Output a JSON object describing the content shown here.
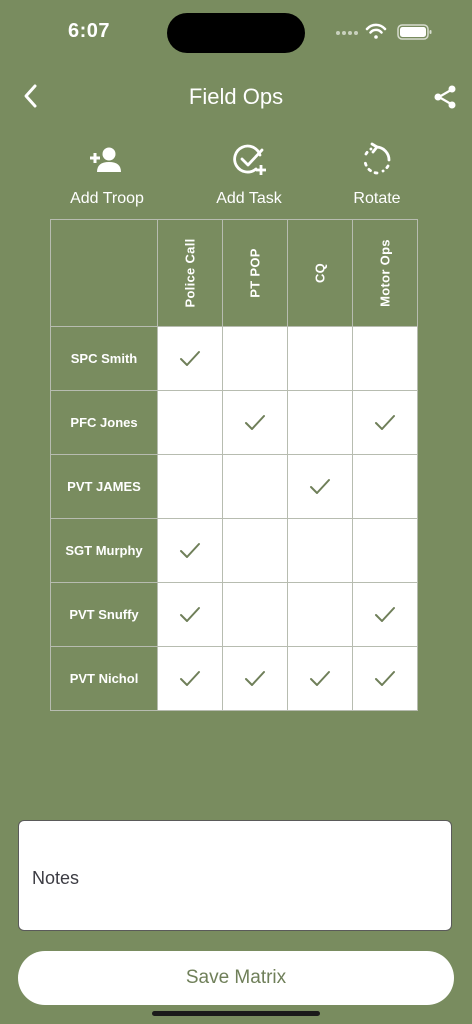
{
  "status": {
    "time": "6:07",
    "icons": [
      "cellular-icon",
      "wifi-icon",
      "battery-icon"
    ]
  },
  "nav": {
    "title": "Field Ops",
    "back_icon": "chevron-left-icon",
    "share_icon": "share-icon"
  },
  "toolbar": {
    "add_troop": {
      "label": "Add Troop",
      "icon": "person-add-icon"
    },
    "add_task": {
      "label": "Add Task",
      "icon": "check-plus-icon"
    },
    "rotate": {
      "label": "Rotate",
      "icon": "rotate-icon"
    }
  },
  "matrix": {
    "columns": [
      "Police Call",
      "PT POP",
      "CQ",
      "Motor Ops"
    ],
    "rows": [
      {
        "name": "SPC Smith",
        "checks": [
          true,
          false,
          false,
          false
        ]
      },
      {
        "name": "PFC Jones",
        "checks": [
          false,
          true,
          false,
          true
        ]
      },
      {
        "name": "PVT JAMES",
        "checks": [
          false,
          false,
          true,
          false
        ]
      },
      {
        "name": "SGT Murphy",
        "checks": [
          true,
          false,
          false,
          false
        ]
      },
      {
        "name": "PVT Snuffy",
        "checks": [
          true,
          false,
          false,
          true
        ]
      },
      {
        "name": "PVT Nichol",
        "checks": [
          true,
          true,
          true,
          true
        ]
      }
    ]
  },
  "notes": {
    "label": "Notes"
  },
  "save": {
    "label": "Save Matrix"
  },
  "colors": {
    "background": "#798c5f",
    "check": "#6f7f59",
    "accent": "#ffffff"
  }
}
